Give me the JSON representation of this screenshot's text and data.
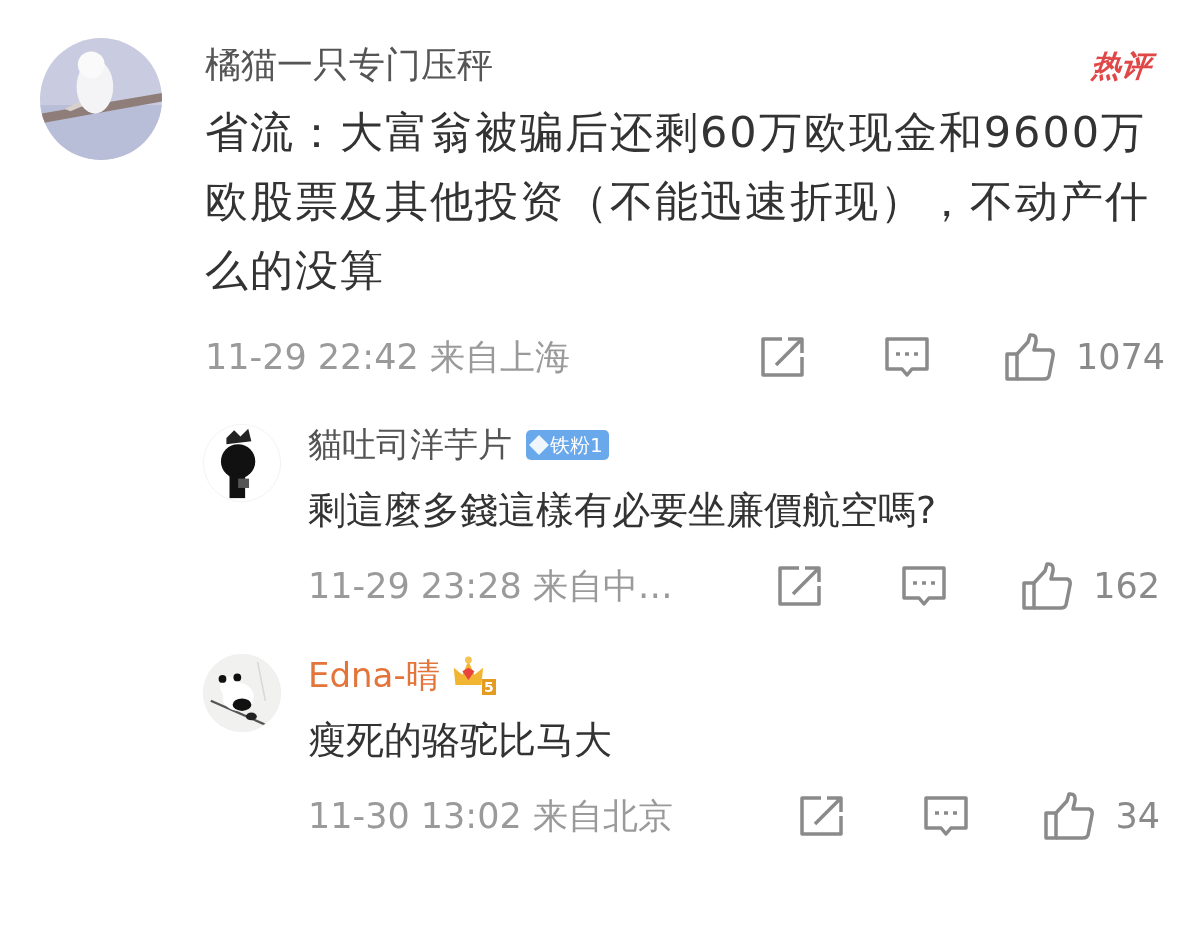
{
  "comment": {
    "author": "橘猫一只专门压秤",
    "hot_badge": "热评",
    "text": "省流：大富翁被骗后还剩60万欧现金和9600万欧股票及其他投资（不能迅速折现），不动产什么的没算",
    "time": "11-29 22:42",
    "location": "来自上海",
    "likes": "1074",
    "replies": [
      {
        "author": "貓吐司洋芋片",
        "kind": "plain",
        "fan_badge": "铁粉1",
        "text": "剩這麼多錢這樣有必要坐廉價航空嗎?",
        "time": "11-29 23:28",
        "location": "来自中…",
        "likes": "162"
      },
      {
        "author": "Edna-晴",
        "kind": "vip",
        "vip_level": "5",
        "text": "瘦死的骆驼比马大",
        "time": "11-30 13:02",
        "location": "来自北京",
        "likes": "34"
      }
    ]
  }
}
